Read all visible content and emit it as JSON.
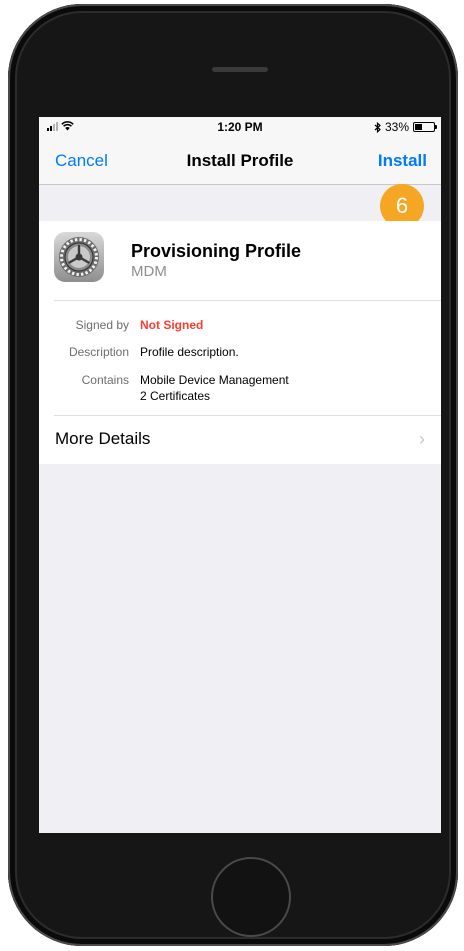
{
  "status_bar": {
    "time": "1:20 PM",
    "battery": "33%",
    "battery_level": 0.33
  },
  "navbar": {
    "cancel": "Cancel",
    "title": "Install Profile",
    "install": "Install"
  },
  "step_badge": "6",
  "profile": {
    "name": "Provisioning Profile",
    "subtitle": "MDM",
    "icon": "settings-gear-icon",
    "details": [
      {
        "label": "Signed by",
        "value": "Not Signed"
      },
      {
        "label": "Description",
        "value": "Profile description."
      },
      {
        "label": "Contains",
        "value": "Mobile Device Management",
        "value2": "2 Certificates"
      }
    ],
    "more_details": "More Details"
  },
  "colors": {
    "accent": "#007aff",
    "warning": "#ff3b30",
    "badge": "#f5a623"
  }
}
